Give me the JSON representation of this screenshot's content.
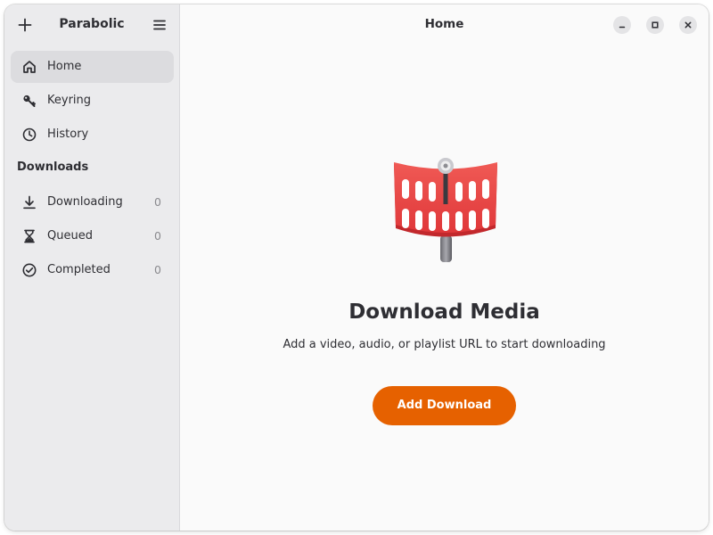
{
  "sidebar": {
    "title": "Parabolic",
    "add_icon": "plus-icon",
    "menu_icon": "hamburger-menu-icon",
    "items": [
      {
        "label": "Home",
        "icon": "home-icon",
        "selected": true
      },
      {
        "label": "Keyring",
        "icon": "key-icon"
      },
      {
        "label": "History",
        "icon": "clock-icon"
      }
    ],
    "downloads_heading": "Downloads",
    "downloads": [
      {
        "label": "Downloading",
        "icon": "download-arrow-icon",
        "count": "0"
      },
      {
        "label": "Queued",
        "icon": "hourglass-icon",
        "count": "0"
      },
      {
        "label": "Completed",
        "icon": "check-circle-icon",
        "count": "0"
      }
    ]
  },
  "header": {
    "title": "Home",
    "window_controls": [
      "minimize-icon",
      "maximize-icon",
      "close-icon"
    ]
  },
  "status_page": {
    "logo_icon": "parabolic-logo-icon",
    "title": "Download Media",
    "description": "Add a video, audio, or playlist URL to start downloading",
    "button_label": "Add Download"
  },
  "colors": {
    "accent": "#e66100",
    "logo_red": "#e63e3e",
    "sidebar_bg": "#ebebed",
    "content_bg": "#fafafa"
  }
}
